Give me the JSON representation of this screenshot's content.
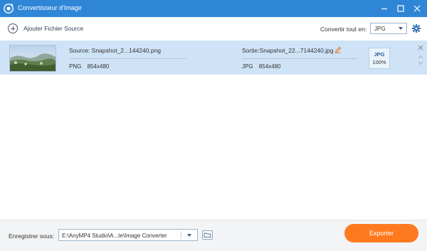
{
  "window": {
    "title": "Convertisseur d'Image",
    "icon": "app-logo-icon",
    "controls": [
      "minimize-icon",
      "maximize-icon",
      "close-icon"
    ]
  },
  "toolbar": {
    "add_label": "Ajouter Fichier Source",
    "convert_all_label": "Convertir tout en:",
    "convert_all_value": "JPG",
    "settings_icon": "gear-icon"
  },
  "files": [
    {
      "source_label": "Source: Snapshot_2...144240.png",
      "source_format": "PNG",
      "source_size": "854x480",
      "output_label": "Sortie:Snapshot_22...7144240.jpg",
      "output_format": "JPG",
      "output_size": "854x480",
      "badge_format": "JPG",
      "badge_quality": "100%"
    }
  ],
  "bottom": {
    "save_label": "Enregistrer sous:",
    "path_value": "E:\\AnyMP4 Studio\\A...te\\Image Converter",
    "export_label": "Exporter"
  },
  "colors": {
    "titlebar": "#2f86d6",
    "row_selected": "#cfe3f7",
    "export": "#ff7a1f",
    "accent": "#2c5b94"
  }
}
